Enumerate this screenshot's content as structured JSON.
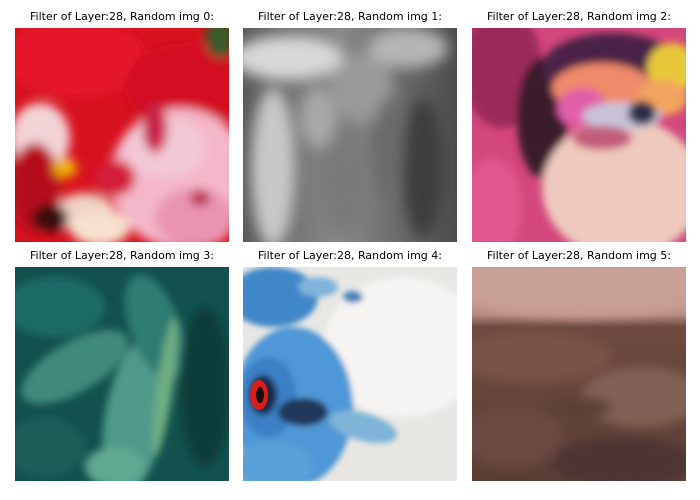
{
  "figure": {
    "panels": [
      {
        "title": "Filter of Layer:28, Random img 0:",
        "image": "red flower petals close-up"
      },
      {
        "title": "Filter of Layer:28, Random img 1:",
        "image": "grayscale blurred texture"
      },
      {
        "title": "Filter of Layer:28, Random img 2:",
        "image": "eye with colorful makeup"
      },
      {
        "title": "Filter of Layer:28, Random img 3:",
        "image": "green fern leaves"
      },
      {
        "title": "Filter of Layer:28, Random img 4:",
        "image": "blue crowned pigeon with red eye"
      },
      {
        "title": "Filter of Layer:28, Random img 5:",
        "image": "brown sand dune landscape"
      }
    ]
  }
}
